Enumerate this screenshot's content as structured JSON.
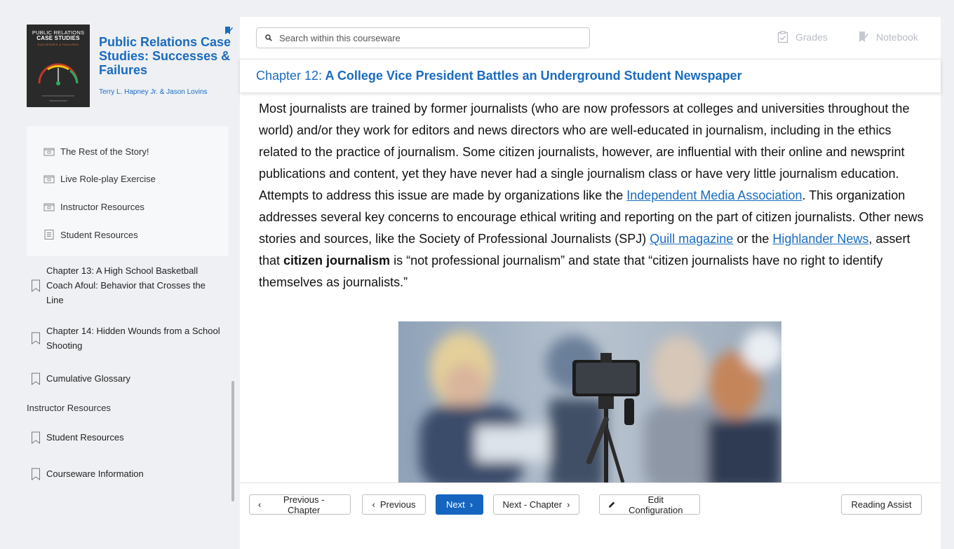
{
  "book": {
    "cover_line1": "PUBLIC RELATIONS",
    "cover_line2": "CASE STUDIES",
    "cover_sub": "SUCCESSES & FAILURES",
    "title": "Public Relations Case Studies: Successes & Failures",
    "authors": "Terry L. Hapney Jr. & Jason Lovins"
  },
  "sidebar": {
    "sub_items": [
      {
        "label": "The Rest of the Story!",
        "icon": "folder-icon"
      },
      {
        "label": "Live Role-play Exercise",
        "icon": "folder-icon"
      },
      {
        "label": "Instructor Resources",
        "icon": "folder-icon"
      },
      {
        "label": "Student Resources",
        "icon": "document-icon"
      }
    ],
    "toc": [
      {
        "label": "Chapter 13: A High School Basketball Coach Afoul: Behavior that Crosses the Line"
      },
      {
        "label": "Chapter 14: Hidden Wounds from a School Shooting"
      },
      {
        "label": "Cumulative Glossary"
      }
    ],
    "section_label": "Instructor Resources",
    "toc_after": [
      {
        "label": "Student Resources"
      },
      {
        "label": "Courseware Information"
      }
    ]
  },
  "topbar": {
    "search_placeholder": "Search within this courseware",
    "grades_label": "Grades",
    "notebook_label": "Notebook"
  },
  "chapter": {
    "prefix": "Chapter 12: ",
    "title": "A College Vice President Battles an Underground Student Newspaper"
  },
  "content": {
    "p1": "Most journalists are trained by former journalists (who are now professors at colleges and universities throughout the world) and/or they work for editors and news directors who are well-educated in journalism, including in the ethics related to the practice of journalism. Some citizen journalists, however, are influential with their online and newsprint publications and content, yet they have never had a single journalism class or have very little journalism education. Attempts to address this issue are made by organizations like the ",
    "link1": "Independent Media Association",
    "p2": ". This organization addresses several key concerns to encourage ethical writing and reporting on the part of citizen journalists. Other news stories and sources, like the Society of Professional Journalists (SPJ) ",
    "link2": "Quill magazine",
    "p3": " or the ",
    "link3": "Highlander News",
    "p4": ", assert that ",
    "bold": "citizen journalism",
    "p5": " is “not professional journalism” and state that “citizen journalists have no right to identify themselves as journalists.”"
  },
  "nav": {
    "prev_chapter": "Previous - Chapter",
    "previous": "Previous",
    "next": "Next",
    "next_chapter": "Next - Chapter",
    "edit_config": "Edit Configuration",
    "reading_assist": "Reading Assist"
  },
  "colors": {
    "accent": "#1a6bbf",
    "primary_button": "#1565c0"
  }
}
